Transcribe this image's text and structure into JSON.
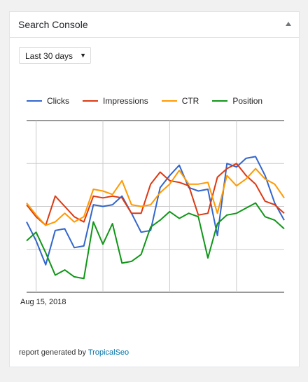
{
  "widget": {
    "title": "Search Console",
    "toggle_icon": "collapse-arrow-up-icon"
  },
  "range_select": {
    "selected": "Last 30 days",
    "arrow": "▼"
  },
  "chart_data": {
    "type": "line",
    "x_labels": [
      {
        "index": 0,
        "label": "Aug 15, 2018"
      }
    ],
    "legend_position": "top-left",
    "grid": true,
    "series": [
      {
        "name": "Clicks",
        "color": "#3366cc",
        "values": [
          33,
          22,
          8,
          28,
          29,
          18,
          19,
          43,
          42,
          43,
          48,
          38,
          27,
          28,
          53,
          60,
          66,
          53,
          51,
          52,
          25,
          67,
          65,
          70,
          71,
          60,
          44,
          34
        ]
      },
      {
        "name": "Impressions",
        "color": "#dc3912",
        "values": [
          43,
          36,
          31,
          48,
          42,
          36,
          33,
          48,
          47,
          48,
          47,
          38,
          38,
          55,
          62,
          57,
          56,
          54,
          37,
          38,
          59,
          64,
          67,
          60,
          55,
          45,
          43,
          38
        ]
      },
      {
        "name": "CTR",
        "color": "#ff9900",
        "values": [
          44,
          37,
          31,
          33,
          38,
          33,
          36,
          52,
          51,
          49,
          57,
          43,
          42,
          43,
          50,
          55,
          63,
          55,
          55,
          56,
          38,
          60,
          54,
          58,
          64,
          58,
          55,
          47
        ]
      },
      {
        "name": "Position",
        "color": "#109618",
        "values": [
          22,
          27,
          15,
          2,
          5,
          1,
          0,
          33,
          20,
          32,
          9,
          10,
          14,
          30,
          34,
          39,
          35,
          38,
          36,
          12,
          32,
          37,
          38,
          41,
          44,
          36,
          34,
          29
        ]
      }
    ]
  },
  "footer": {
    "text": "report generated by ",
    "link": "TropicalSeo"
  }
}
